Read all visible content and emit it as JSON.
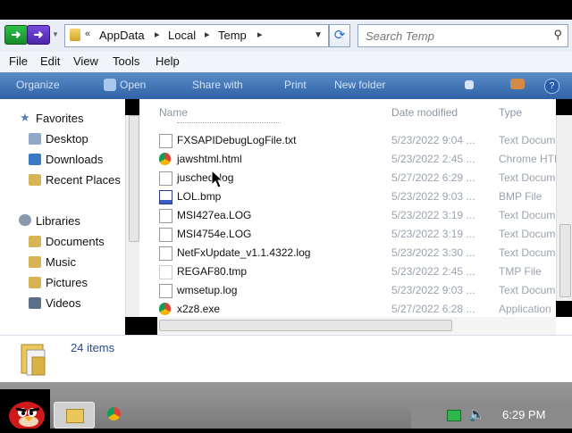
{
  "address": {
    "crumbs": [
      "AppData",
      "Local",
      "Temp"
    ],
    "overflow": "«"
  },
  "search": {
    "placeholder": "Search Temp"
  },
  "menu": [
    "File",
    "Edit",
    "View",
    "Tools",
    "Help"
  ],
  "commands": {
    "organize": "Organize",
    "open": "Open",
    "share": "Share with",
    "print": "Print",
    "new_folder": "New folder"
  },
  "nav": {
    "favorites": "Favorites",
    "fav_items": [
      "Desktop",
      "Downloads",
      "Recent Places"
    ],
    "libraries": "Libraries",
    "lib_items": [
      "Documents",
      "Music",
      "Pictures",
      "Videos"
    ]
  },
  "columns": {
    "name": "Name",
    "date": "Date modified",
    "type": "Type"
  },
  "files": [
    {
      "name": "FXSAPIDebugLogFile.txt",
      "date": "5/23/2022 9:04 ...",
      "type": "Text Document",
      "icon": "text-file-icon"
    },
    {
      "name": "jawshtml.html",
      "date": "5/23/2022 2:45 ...",
      "type": "Chrome HTML",
      "icon": "chrome-icon"
    },
    {
      "name": "juschedl.log",
      "date": "5/27/2022 6:29 ...",
      "type": "Text Document",
      "icon": "text-file-icon"
    },
    {
      "name": "LOL.bmp",
      "date": "5/23/2022 9:03 ...",
      "type": "BMP File",
      "icon": "bmp-file-icon"
    },
    {
      "name": "MSI427ea.LOG",
      "date": "5/23/2022 3:19 ...",
      "type": "Text Document",
      "icon": "text-file-icon"
    },
    {
      "name": "MSI4754e.LOG",
      "date": "5/23/2022 3:19 ...",
      "type": "Text Document",
      "icon": "text-file-icon"
    },
    {
      "name": "NetFxUpdate_v1.1.4322.log",
      "date": "5/23/2022 3:30 ...",
      "type": "Text Document",
      "icon": "text-file-icon"
    },
    {
      "name": "REGAF80.tmp",
      "date": "5/23/2022 2:45 ...",
      "type": "TMP File",
      "icon": "tmp-file-icon"
    },
    {
      "name": "wmsetup.log",
      "date": "5/23/2022 9:03 ...",
      "type": "Text Document",
      "icon": "text-file-icon"
    },
    {
      "name": "x2z8.exe",
      "date": "5/27/2022 6:28 ...",
      "type": "Application",
      "icon": "chrome-icon"
    }
  ],
  "status": {
    "count": "24 items"
  },
  "taskbar": {
    "clock": "6:29 PM"
  }
}
